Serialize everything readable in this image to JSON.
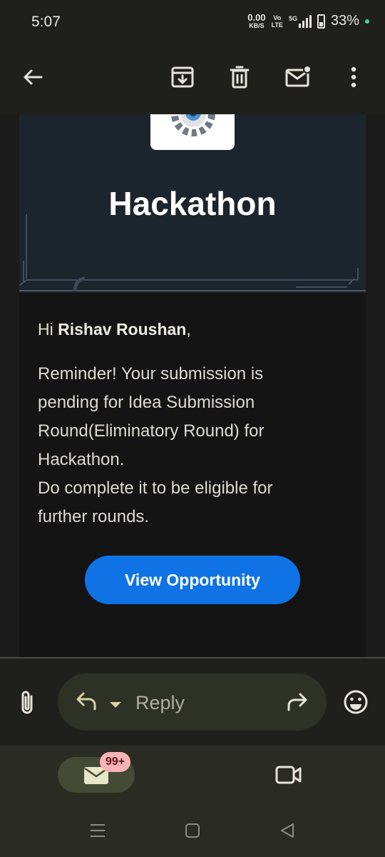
{
  "status_bar": {
    "time": "5:07",
    "net_speed_value": "0.00",
    "net_speed_unit": "KB/S",
    "volte_top": "Vo",
    "volte_bottom": "LTE",
    "network": "5G",
    "battery_pct": "33%",
    "dot_color": "#3dd68c"
  },
  "toolbar": {
    "icons": [
      "back-arrow-icon",
      "archive-icon",
      "delete-icon",
      "mark-unread-icon",
      "more-vert-icon"
    ]
  },
  "email": {
    "banner_title": "Hackathon",
    "greeting_prefix": "Hi ",
    "recipient_name": "Rishav Roushan",
    "greeting_suffix": ",",
    "message_lines": [
      "Reminder! Your submission is",
      "pending for Idea Submission",
      "Round(Eliminatory Round) for",
      "Hackathon.",
      "Do complete it to be eligible for",
      "further rounds."
    ],
    "button_label": "View Opportunity",
    "button_color": "#0f73e6"
  },
  "reply_bar": {
    "reply_label": "Reply",
    "icons": [
      "attachment-icon",
      "reply-icon",
      "dropdown-icon",
      "forward-icon",
      "emoji-icon"
    ]
  },
  "bottom_nav": {
    "mail_badge": "99+",
    "icons": [
      "mail-icon",
      "video-icon"
    ]
  },
  "system_nav": {
    "icons": [
      "recents-icon",
      "home-icon",
      "back-icon"
    ]
  }
}
